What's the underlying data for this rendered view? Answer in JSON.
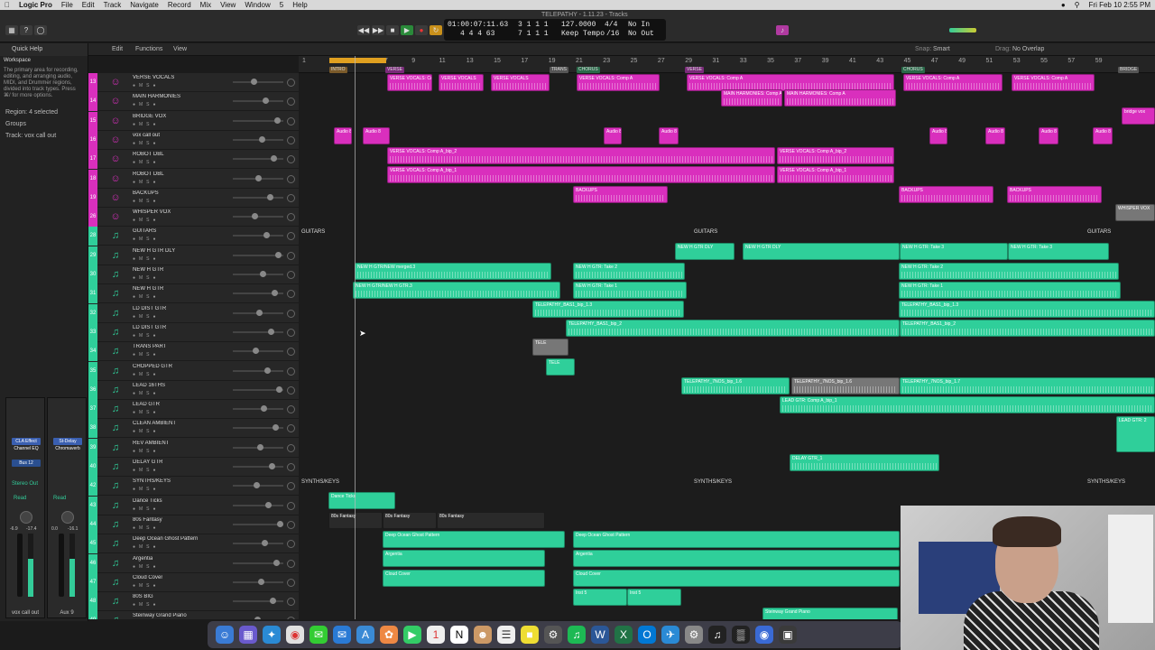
{
  "menubar": {
    "app": "Logic Pro",
    "items": [
      "File",
      "Edit",
      "Track",
      "Navigate",
      "Record",
      "Mix",
      "View",
      "Window",
      "5",
      "Help"
    ],
    "clock": "Fri Feb 10  2:55 PM"
  },
  "window_title": "TELEPATHY - 1.11.23 - Tracks",
  "lcd": {
    "smpte": "01:00:07:11.63",
    "bars": "3 1 1 1",
    "tempo": "127.0000",
    "sig": "4/4",
    "in": "No In",
    "row2a": "4 4 4 63",
    "row2b": "7 1 1 1",
    "keep": "Keep Tempo",
    "div": "/16",
    "out": "No Out"
  },
  "edit_toolbar": {
    "edit": "Edit",
    "functions": "Functions",
    "view": "View",
    "snap_label": "Snap:",
    "snap": "Smart",
    "drag_label": "Drag:",
    "drag": "No Overlap"
  },
  "inspector": {
    "quick_help": "Quick Help",
    "workspace": "Workspace",
    "help_text": "The primary area for recording, editing, and arranging audio, MIDI, and Drummer regions, divided into track types. Press ⌘/ for more options.",
    "region": "Region: 4 selected",
    "groups": "Groups",
    "track": "Track: vox call out",
    "plugin1": "CLA Effect Channel EQ",
    "plugin2": "St-Delay Chromaverb",
    "bus1": "Bus 12",
    "bus2": "Stereo Out",
    "read1": "Read",
    "read2": "Read",
    "strip1_val": "-6.9",
    "strip1_peak": "-17.4",
    "strip2_val": "0.0",
    "strip2_peak": "-16.1",
    "strip1_name": "vox call out",
    "strip2_name": "Aux 9"
  },
  "ruler": {
    "bars": [
      "1",
      "3",
      "5",
      "7",
      "9",
      "11",
      "13",
      "15",
      "17",
      "19",
      "21",
      "23",
      "25",
      "27",
      "29",
      "31",
      "33",
      "35",
      "37",
      "39",
      "41",
      "43",
      "45",
      "47",
      "49",
      "51",
      "53",
      "55",
      "57",
      "59"
    ],
    "markers": [
      {
        "label": "INTRO",
        "color": "#7a5a2a"
      },
      {
        "label": "VERSE",
        "color": "#7a2a7a"
      },
      {
        "label": "TRANS",
        "color": "#555"
      },
      {
        "label": "CHORUS",
        "color": "#2a6a4a"
      },
      {
        "label": "VERSE",
        "color": "#7a2a7a"
      },
      {
        "label": "CHORUS",
        "color": "#2a6a4a"
      },
      {
        "label": "BRIDGE",
        "color": "#555"
      }
    ]
  },
  "tracks": [
    {
      "num": "13",
      "name": "VERSE VOCALS",
      "color": "#d92fbd"
    },
    {
      "num": "14",
      "name": "MAIN HARMONIES",
      "color": "#d92fbd"
    },
    {
      "num": "15",
      "name": "BRIDGE VOX",
      "color": "#d92fbd"
    },
    {
      "num": "16",
      "name": "vox call out",
      "color": "#d92fbd"
    },
    {
      "num": "17",
      "name": "ROBOT DBL",
      "color": "#d92fbd"
    },
    {
      "num": "18",
      "name": "ROBOT DBL",
      "color": "#d92fbd"
    },
    {
      "num": "19",
      "name": "BACKUPS",
      "color": "#d92fbd"
    },
    {
      "num": "26",
      "name": "WHISPER VOX",
      "color": "#d92fbd"
    },
    {
      "num": "28",
      "name": "GUITARS",
      "color": "#2fcf9a"
    },
    {
      "num": "29",
      "name": "NEW H GTR DLY",
      "color": "#2fcf9a"
    },
    {
      "num": "30",
      "name": "NEW H GTR",
      "color": "#2fcf9a"
    },
    {
      "num": "31",
      "name": "NEW H GTR",
      "color": "#2fcf9a"
    },
    {
      "num": "32",
      "name": "LD DIST GTR",
      "color": "#2fcf9a"
    },
    {
      "num": "33",
      "name": "LD DIST GTR",
      "color": "#2fcf9a"
    },
    {
      "num": "34",
      "name": "TRANS PART",
      "color": "#2fcf9a"
    },
    {
      "num": "35",
      "name": "CHOPPED GTR",
      "color": "#2fcf9a"
    },
    {
      "num": "36",
      "name": "LEAD 16THS",
      "color": "#2fcf9a"
    },
    {
      "num": "37",
      "name": "LEAD GTR",
      "color": "#2fcf9a"
    },
    {
      "num": "38",
      "name": "CLEAN AMBIENT",
      "color": "#2fcf9a"
    },
    {
      "num": "39",
      "name": "REV AMBIENT",
      "color": "#2fcf9a"
    },
    {
      "num": "40",
      "name": "DELAY GTR",
      "color": "#2fcf9a"
    },
    {
      "num": "42",
      "name": "SYNTHS/KEYS",
      "color": "#2fcf9a"
    },
    {
      "num": "43",
      "name": "Dance Ticks",
      "color": "#2fcf9a"
    },
    {
      "num": "44",
      "name": "80s Fantasy",
      "color": "#2fcf9a"
    },
    {
      "num": "45",
      "name": "Deep Ocean Ghost Pattern",
      "color": "#2fcf9a"
    },
    {
      "num": "46",
      "name": "Argentia",
      "color": "#2fcf9a"
    },
    {
      "num": "47",
      "name": "Cloud Cover",
      "color": "#2fcf9a"
    },
    {
      "num": "48",
      "name": "80S BIG",
      "color": "#2fcf9a"
    },
    {
      "num": "49",
      "name": "Steinway Grand Piano",
      "color": "#2fcf9a"
    }
  ],
  "folders": {
    "guitars": "GUITARS",
    "guitars_right": "GUITARS",
    "guitars_far": "GUITARS",
    "synths": "SYNTHS/KEYS",
    "synths_mid": "SYNTHS/KEYS",
    "synths_far": "SYNTHS/KEYS"
  },
  "regions": {
    "verse_vocals_1": "VERSE VOCALS: Comp A",
    "verse_vocals_2": "VERSE VOCALS",
    "main_harm_1": "MAIN HARMONIES: Comp A",
    "main_harm_2": "MAIN HARMONIES: Comp A",
    "bridge": "bridge vox",
    "audio": "Audio 8",
    "robot_1": "VERSE VOCALS: Comp A_bip_2",
    "robot_2": "VERSE VOCALS: Comp A_bip_2",
    "robot_3": "VERSE VOCALS: Comp A_bip_1",
    "robot_4": "VERSE VOCALS: Comp A_bip_1",
    "backups": "BACKUPS",
    "whisper": "WHISPER VOX",
    "gtr_dly_1": "NEW H GTR DLY",
    "gtr_dly_2": "NEW H GTR DLY",
    "gtr_dly_3": "NEW H GTR: Take 3",
    "gtr_dly_4": "NEW H GTR: Take 3",
    "gtr_a1": "NEW H GTR/NEW merged.3",
    "gtr_a2": "NEW H GTR: Take 2",
    "gtr_a3": "NEW H GTR: Take 2",
    "gtr_b1": "NEW H GTR/NEW H GTR.3",
    "gtr_b2": "NEW H GTR: Take 1",
    "gtr_b3": "NEW H GTR: Take 1",
    "ld_1": "TELEPATHY_BAS1_bip_1.3",
    "ld_2": "TELEPATHY_BAS1_bip_1.3",
    "ld_3": "TELEPATHY_BAS1_bip_2",
    "ld_4": "TELEPATHY_BAS1_bip_2",
    "trans": "TELE",
    "chopped": "TELE",
    "lead16": "TELEPATHY_7NOS_bip_1.6",
    "lead16_b": "TELEPATHY_7NOS_bip_1.6",
    "lead16_c": "TELEPATHY_7NOS_bip_1.7",
    "lead_gtr": "LEAD GTR: Comp A_bip_1",
    "lead_right": "LEAD GTR: 2",
    "delay": "DELAY GTR_1",
    "dance": "Dance Ticks",
    "fantasy_1": "80s Fantasy",
    "fantasy_2": "80s Fantasy",
    "fantasy_3": "80s Fantasy",
    "deep": "Deep Ocean Ghost Pattern",
    "argentia": "Argentia",
    "cloud": "Cloud Cover",
    "big_1": "Inst 5",
    "big_2": "Inst 5",
    "piano": "Steinway Grand Piano"
  }
}
